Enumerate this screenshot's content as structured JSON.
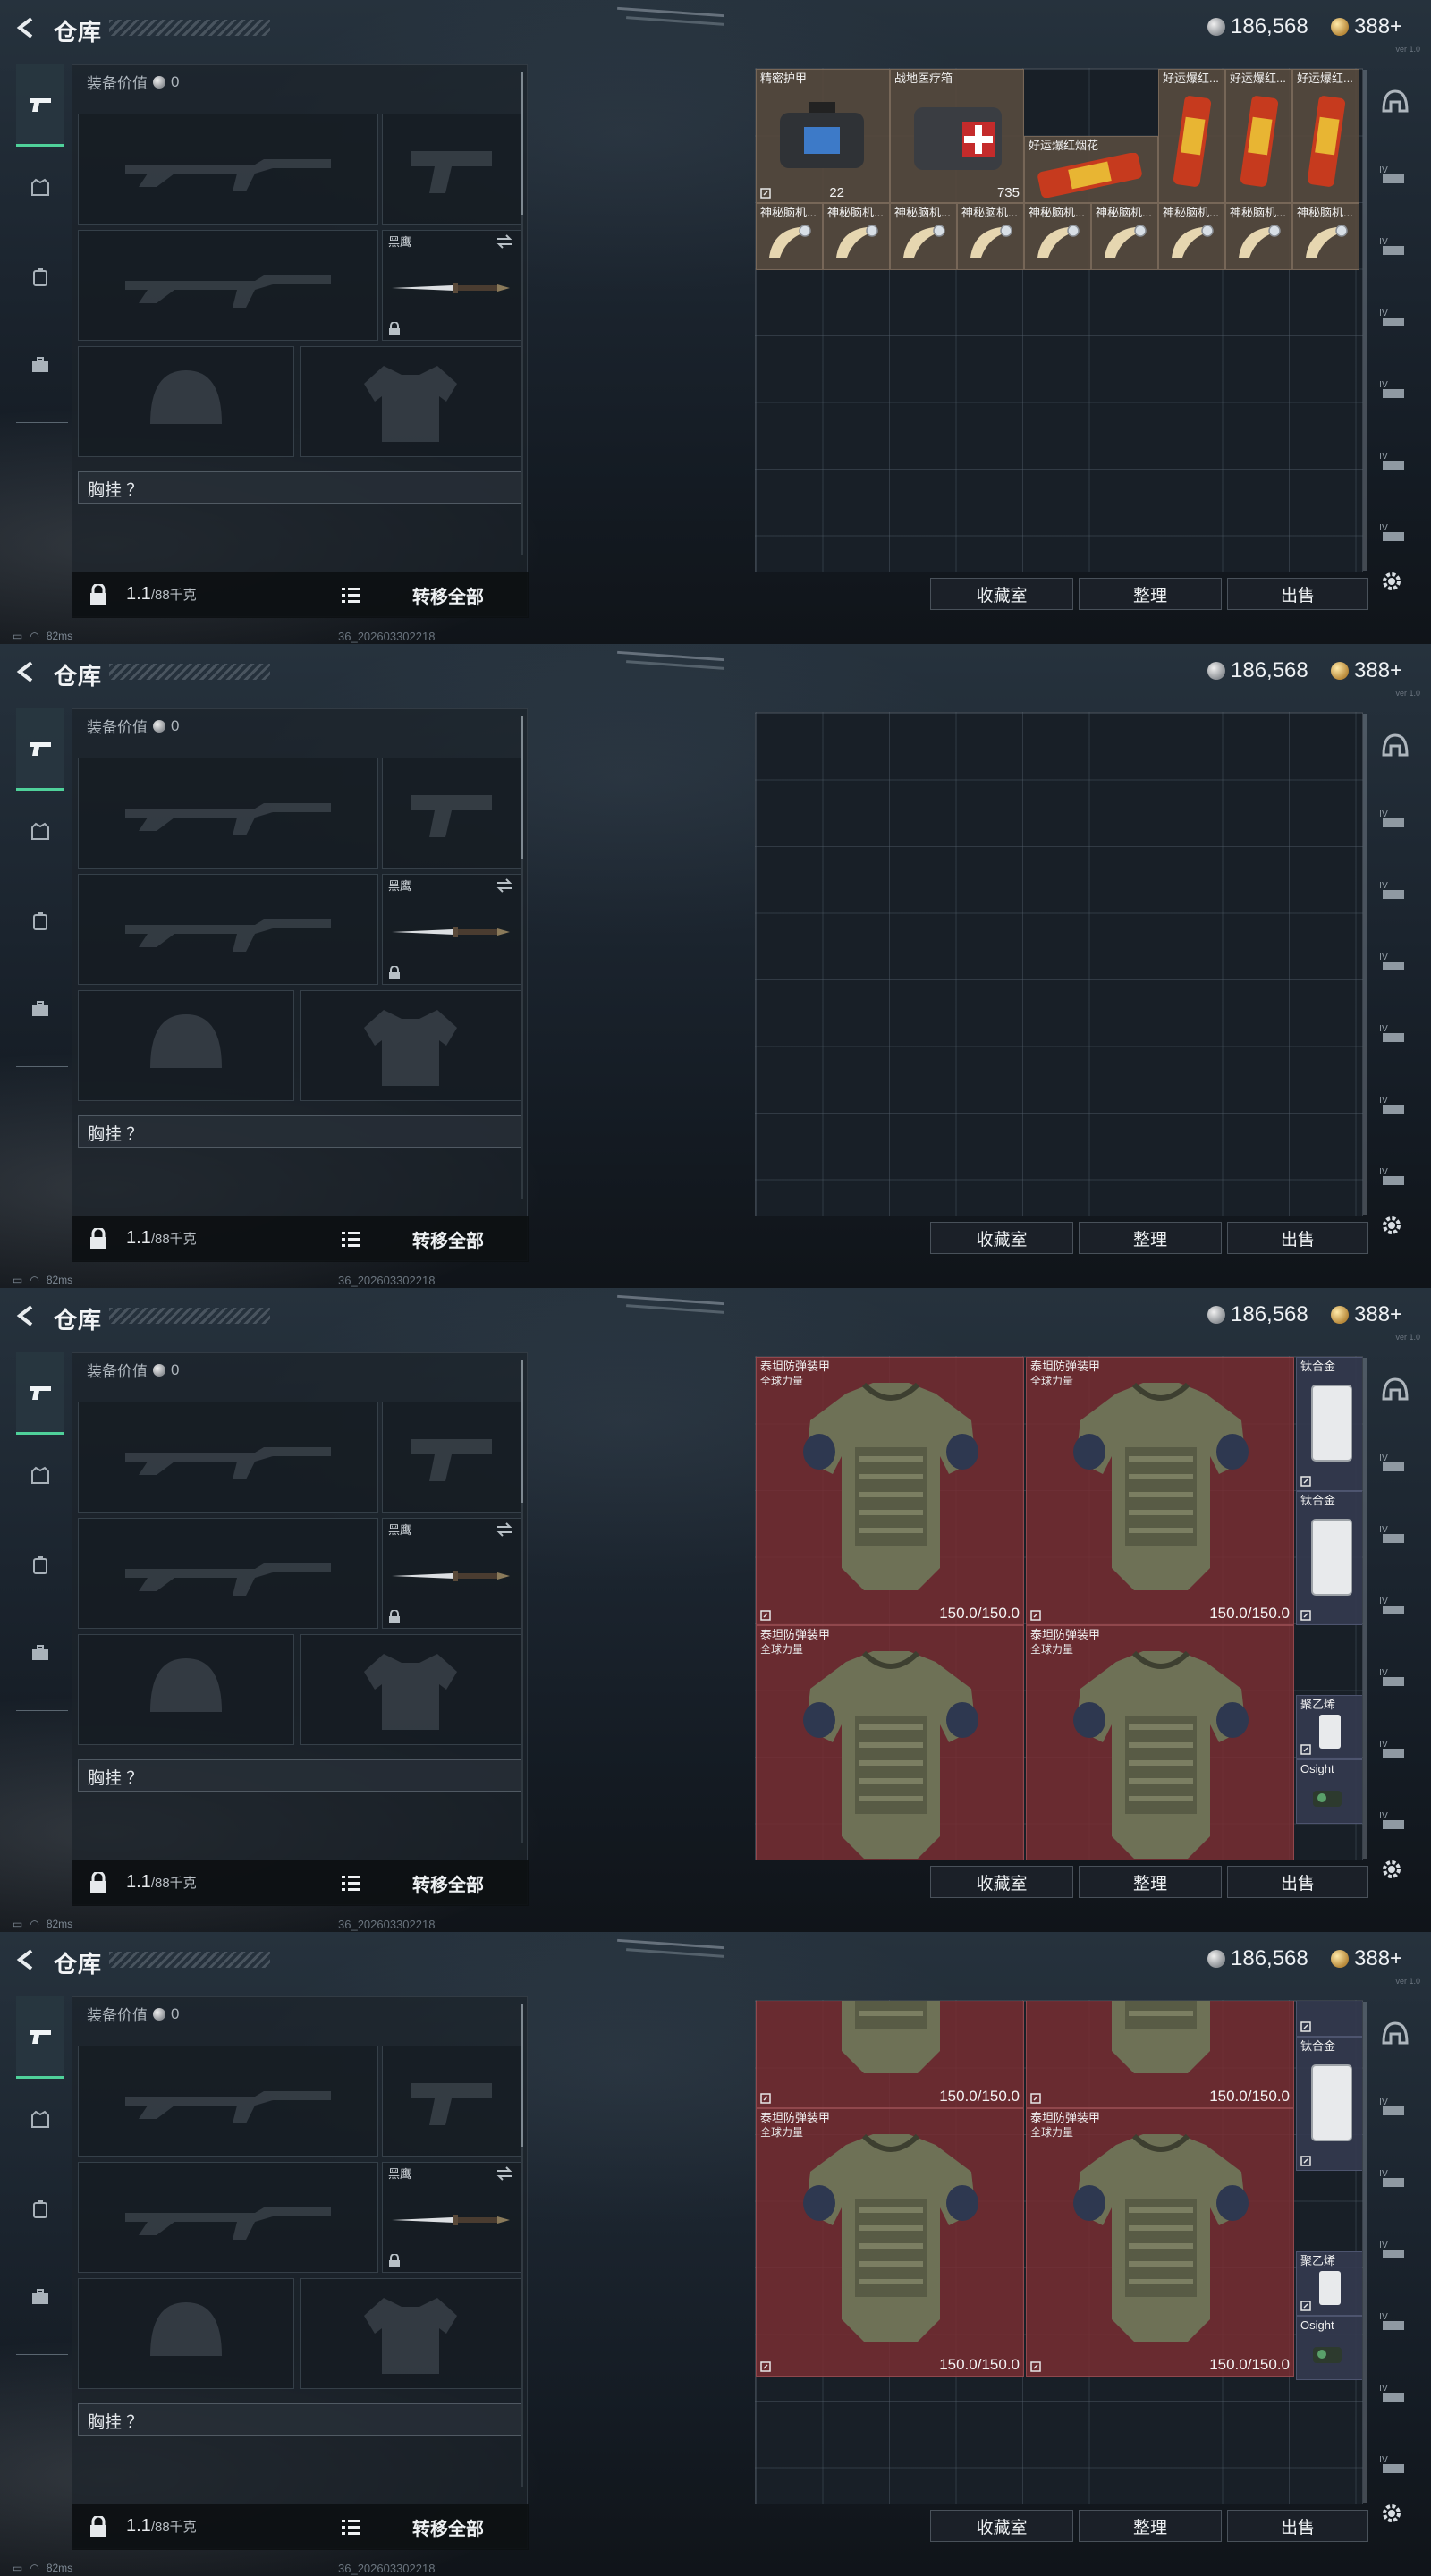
{
  "app": {
    "title": "仓库",
    "currency_silver": "186,568",
    "currency_gold": "388+",
    "version": "ver 1.0"
  },
  "equipment": {
    "value_label": "装备价值",
    "value": "0",
    "knife_label": "黑鹰",
    "chest_rig_label": "胸挂 ？",
    "weight": "1.1",
    "weight_unit": "/88千克",
    "transfer_all": "转移全部"
  },
  "buttons": {
    "collection": "收藏室",
    "sort": "整理",
    "sell": "出售"
  },
  "status": {
    "ping": "82ms",
    "build": "36_202603302218"
  },
  "storage_page1": {
    "medkit_count": "735",
    "case_count": "22",
    "items": [
      {
        "name": "精密护甲"
      },
      {
        "name": "战地医疗箱"
      },
      {
        "name": "好运爆红..."
      },
      {
        "name": "好运爆红..."
      },
      {
        "name": "好运爆红..."
      },
      {
        "name": "好运爆红烟花"
      },
      {
        "name": "神秘脑机..."
      },
      {
        "name": "神秘脑机..."
      },
      {
        "name": "神秘脑机..."
      },
      {
        "name": "神秘脑机..."
      },
      {
        "name": "神秘脑机..."
      },
      {
        "name": "神秘脑机..."
      },
      {
        "name": "神秘脑机..."
      },
      {
        "name": "神秘脑机..."
      },
      {
        "name": "神秘脑机..."
      }
    ]
  },
  "storage_page3": {
    "armor_name": "泰坦防弹装甲",
    "armor_sub": "全球力量",
    "armor_durability": "150.0/150.0",
    "plate_name": "钛合金",
    "poly_name": "聚乙烯",
    "sight_name": "Osight"
  },
  "colors": {
    "accent": "#4fd19a",
    "armor_bg": "#782e32"
  },
  "icons": [
    "back-arrow-icon",
    "silver-coin-icon",
    "gold-coin-icon",
    "pistol-icon",
    "armor-icon",
    "backpack-icon",
    "case-icon",
    "lock-icon",
    "list-icon",
    "settings-icon",
    "helmet-icon",
    "ammo-icon"
  ]
}
